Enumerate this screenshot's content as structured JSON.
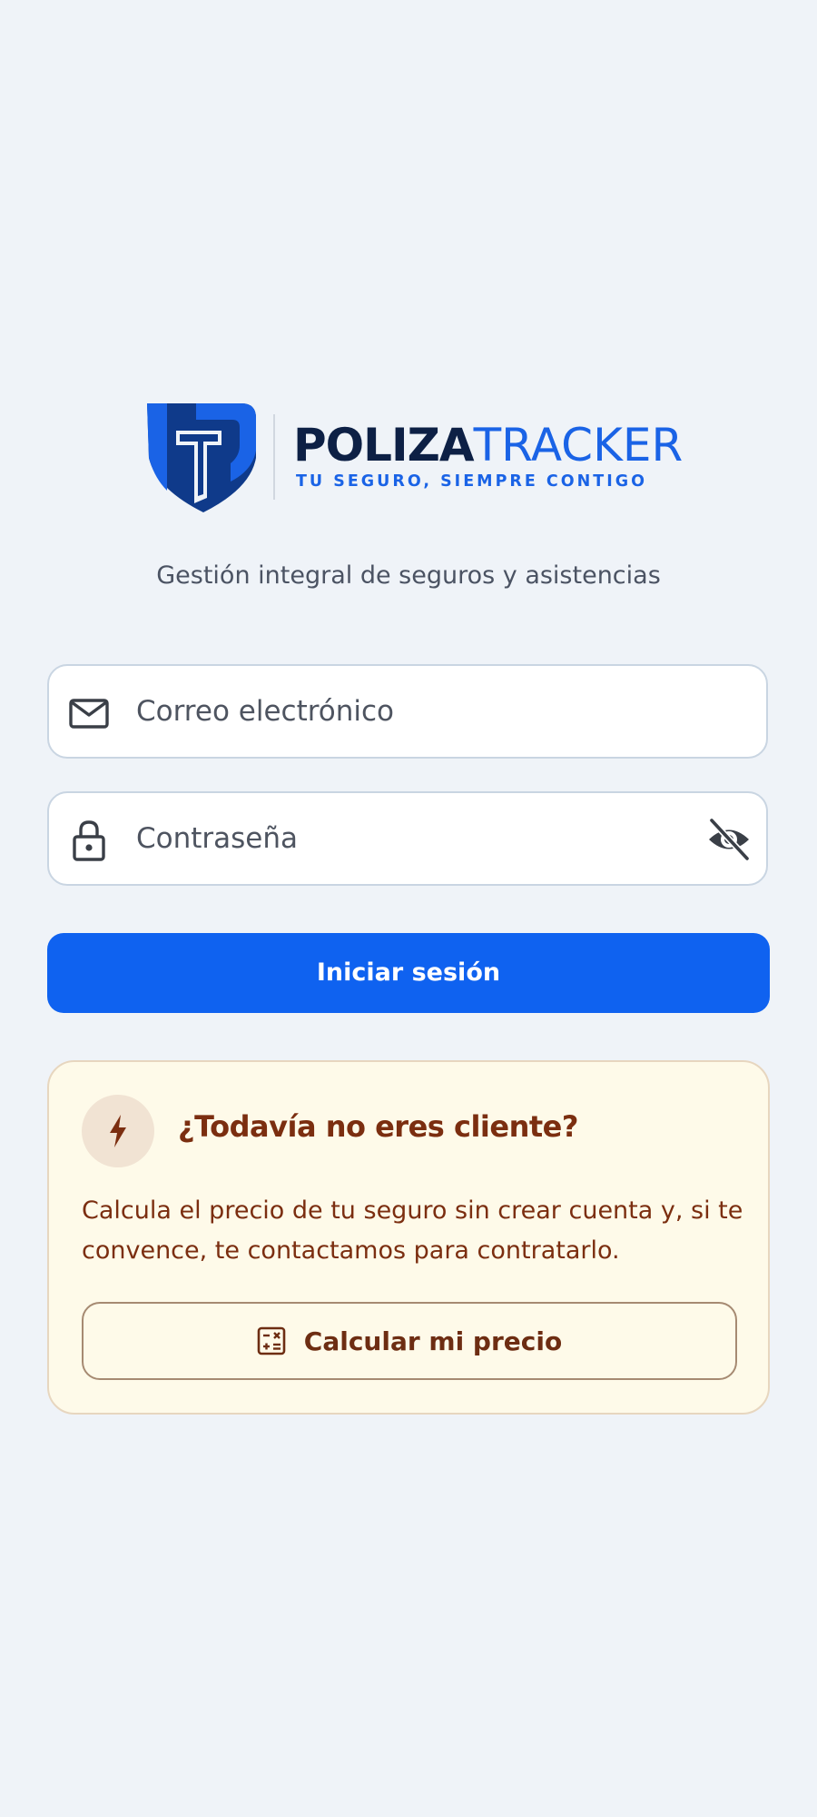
{
  "brand": {
    "name_part1": "POLIZA",
    "name_part2": "TRACKER",
    "tagline": "TU SEGURO, SIEMPRE CONTIGO",
    "primary_color": "#0f62f0",
    "dark_color": "#0d2045"
  },
  "subtitle": "Gestión integral de seguros y asistencias",
  "login": {
    "email_placeholder": "Correo electrónico",
    "email_icon": "mail-icon",
    "password_placeholder": "Contraseña",
    "password_icon": "lock-icon",
    "toggle_icon": "eye-off-icon",
    "submit_label": "Iniciar sesión"
  },
  "promo": {
    "icon": "lightning-icon",
    "title": "¿Todavía no eres cliente?",
    "text": "Calcula el precio de tu seguro sin crear cuenta y, si te convence, te contactamos para contratarlo.",
    "button_icon": "calculator-icon",
    "button_label": "Calcular mi precio",
    "background_color": "#fefae9",
    "text_color": "#7b2e10"
  }
}
